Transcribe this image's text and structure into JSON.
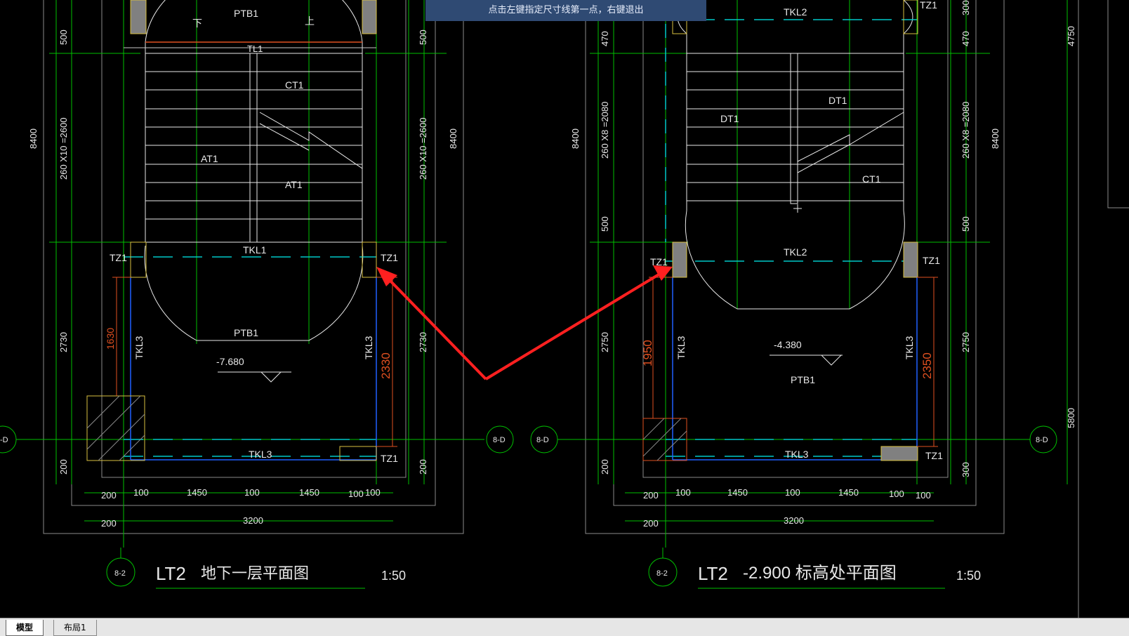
{
  "prompt": {
    "message": "点击左键指定尺寸线第一点，右键退出"
  },
  "tabs": [
    {
      "label": "模型",
      "active": true
    },
    {
      "label": "布局1",
      "active": false
    }
  ],
  "colors": {
    "background": "#000000",
    "grid": "#00c000",
    "wall": "#ffffff",
    "beam_dash": "#00c8c8",
    "column_outline": "#d8c040",
    "column_fill": "#808080",
    "dim_red": "#e05020",
    "annotation_arrow": "#ff2020",
    "blue": "#2060ff"
  },
  "drawing": {
    "left": {
      "title": "LT2",
      "subtitle": "地下一层平面图",
      "scale": "1:50",
      "axis_bottom": "8-2",
      "axis_right": "8-D",
      "axis_left": "-D",
      "labels": {
        "ptb_top": "PTB1",
        "down": "下",
        "up": "上",
        "tl": "TL1",
        "ct": "CT1",
        "at_left": "AT1",
        "at_right": "AT1",
        "tz_left": "TZ1",
        "tz_right": "TZ1",
        "tkl_mid": "TKL1",
        "ptb_bottom": "PTB1",
        "elev": "-7.680",
        "tkl3_left": "TKL3",
        "tkl3_right": "TKL3",
        "tkl3_bottom": "TKL3",
        "tz_bottom_right": "TZ1"
      },
      "dims_left": [
        "500",
        "8400",
        "260 X10 =2600",
        "2730",
        "200"
      ],
      "dims_right": [
        "500",
        "260 X10 =2600",
        "8400",
        "2730",
        "200"
      ],
      "dims_red": [
        "1630",
        "2330"
      ],
      "dims_bottom_row1": [
        "200",
        "100",
        "1450",
        "100",
        "1450",
        "100",
        "100"
      ],
      "dims_bottom_row2": [
        "200",
        "3200"
      ]
    },
    "right": {
      "title": "LT2",
      "subtitle": "-2.900  标高处平面图",
      "scale": "1:50",
      "axis_bottom": "8-2",
      "axis_left": "8-D",
      "axis_right": "8-D",
      "labels": {
        "tkl_top": "TKL2",
        "tz_top": "TZ1",
        "dt_left": "DT1",
        "dt_right": "DT1",
        "ct": "CT1",
        "tz_left": "TZ1",
        "tz_right": "TZ1",
        "tkl_mid": "TKL2",
        "elev": "-4.380",
        "ptb": "PTB1",
        "tkl3_left": "TKL3",
        "tkl3_right": "TKL3",
        "tkl3_bottom": "TKL3",
        "tz_bottom_right": "TZ1"
      },
      "dims_left": [
        "470",
        "8400",
        "260 X8 =2080",
        "500",
        "2750",
        "200"
      ],
      "dims_right": [
        "300",
        "470",
        "260 X8 =2080",
        "8400",
        "500",
        "2750",
        "300",
        "4750",
        "5800"
      ],
      "dims_red": [
        "1950",
        "2350"
      ],
      "dims_bottom_row1": [
        "200",
        "100",
        "1450",
        "100",
        "1450",
        "100",
        "100"
      ],
      "dims_bottom_row2": [
        "200",
        "3200"
      ]
    }
  }
}
